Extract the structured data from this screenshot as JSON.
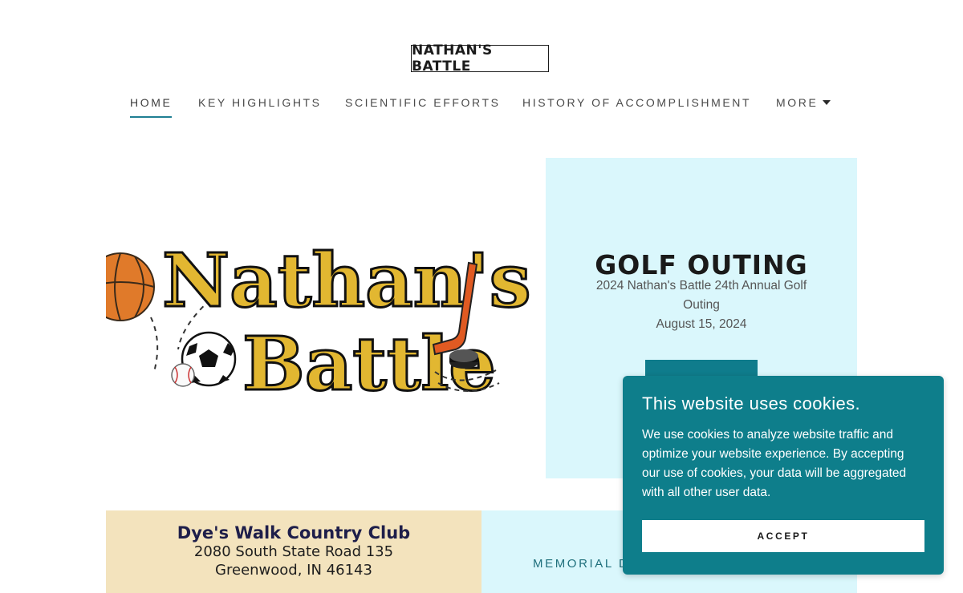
{
  "site": {
    "brand": "NATHAN'S BATTLE"
  },
  "nav": {
    "items": [
      "HOME",
      "KEY HIGHLIGHTS",
      "SCIENTIFIC EFFORTS",
      "HISTORY OF ACCOMPLISHMENT",
      "MORE"
    ],
    "active": "HOME",
    "accent_color": "#1f7f93"
  },
  "hero": {
    "logo_text": {
      "line1": "Nathan's",
      "line2": "Battle"
    },
    "title": "GOLF OUTING",
    "line1": "2024 Nathan's Battle 24th Annual Golf",
    "line2": "Outing",
    "date": "August 15, 2024",
    "panel_color": "#daf7fc",
    "button_color": "#0f7c8c"
  },
  "venue": {
    "name": "Dye's Walk Country Club",
    "address1": "2080 South State Road 135",
    "address2": "Greenwood, IN 46143",
    "bg_color": "#f3e3bd"
  },
  "memorial": {
    "label": "MEMORIAL D"
  },
  "cookie": {
    "title": "This website uses cookies.",
    "text": "We use cookies to analyze website traffic and optimize your website experience. By accepting our use of cookies, your data will be aggregated with all other user data.",
    "accept_label": "ACCEPT",
    "bg_color": "#0e7e8b"
  },
  "icons": [
    "basketball-icon",
    "soccer-ball-icon",
    "baseball-icon",
    "hockey-stick-icon",
    "hockey-puck-icon",
    "caret-down-icon"
  ]
}
